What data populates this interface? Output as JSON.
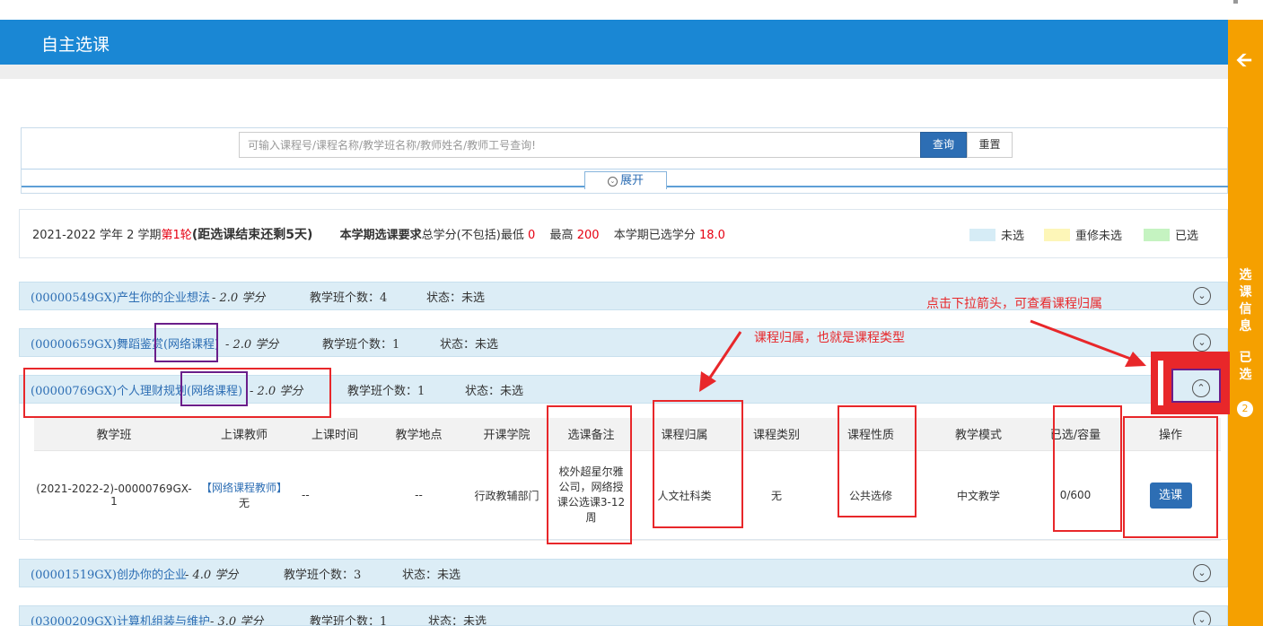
{
  "page": {
    "title": "自主选课"
  },
  "search": {
    "placeholder": "可输入课程号/课程名称/教学班名称/教师姓名/教师工号查询!",
    "query_label": "查询",
    "reset_label": "重置",
    "expand_label": "展开"
  },
  "term_info": {
    "term": "2021-2022 学年 2 学期",
    "round": "第1轮",
    "remaining_open": "(",
    "remaining": "距选课结束还剩5天",
    "remaining_close": ")",
    "requirement_label": "本学期选课要求",
    "requirement_text": "总学分(不包括)最低",
    "min": "0",
    "max_label": "最高",
    "max": "200",
    "selected_label": "本学期已选学分",
    "selected": "18.0"
  },
  "legend": {
    "unselected": "未选",
    "retake_unselected": "重修未选",
    "selected": "已选",
    "colors": {
      "unselected": "#d6ecf6",
      "retake_unselected": "#fdf6b8",
      "selected": "#c5f3c1"
    }
  },
  "courses": [
    {
      "name": "(00000549GX)产生你的企业想法",
      "credit": "- 2.0 学分",
      "class_count": "教学班个数：4",
      "status": "状态：未选"
    },
    {
      "name_prefix": "(00000659GX)舞蹈鉴赏",
      "name_tag": "(网络课程)",
      "credit": "- 2.0 学分",
      "class_count": "教学班个数：1",
      "status": "状态：未选"
    },
    {
      "name_prefix": "(00000769GX)个人理财规划",
      "name_tag": "(网络课程)",
      "credit": "- 2.0 学分",
      "class_count": "教学班个数：1",
      "status": "状态：未选"
    },
    {
      "name": "(00001519GX)创办你的企业",
      "credit": "- 4.0 学分",
      "class_count": "教学班个数：3",
      "status": "状态：未选"
    },
    {
      "name": "(03000209GX)计算机组装与维护",
      "credit": "- 3.0 学分",
      "class_count": "教学班个数：1",
      "status": "状态：未选"
    }
  ],
  "detail": {
    "headers": [
      "教学班",
      "上课教师",
      "上课时间",
      "教学地点",
      "开课学院",
      "选课备注",
      "课程归属",
      "课程类别",
      "课程性质",
      "教学模式",
      "已选/容量",
      "操作"
    ],
    "row": {
      "class": "(2021-2022-2)-00000769GX-1",
      "teacher_link": "【网络课程教师】",
      "teacher_name": "无",
      "time": "--",
      "place": "--",
      "college": "行政教辅部门",
      "note": "校外超星尔雅公司，网络授课公选课3-12周",
      "attribution": "人文社科类",
      "category": "无",
      "nature": "公共选修",
      "mode": "中文教学",
      "capacity": "0/600",
      "action": "选课"
    }
  },
  "sidebar": {
    "line1": "选课信息",
    "line2": "已选",
    "count": "2"
  },
  "annotations": {
    "dropdown_hint": "点击下拉箭头，可查看课程归属",
    "attribution_hint": "课程归属，也就是课程类型"
  }
}
